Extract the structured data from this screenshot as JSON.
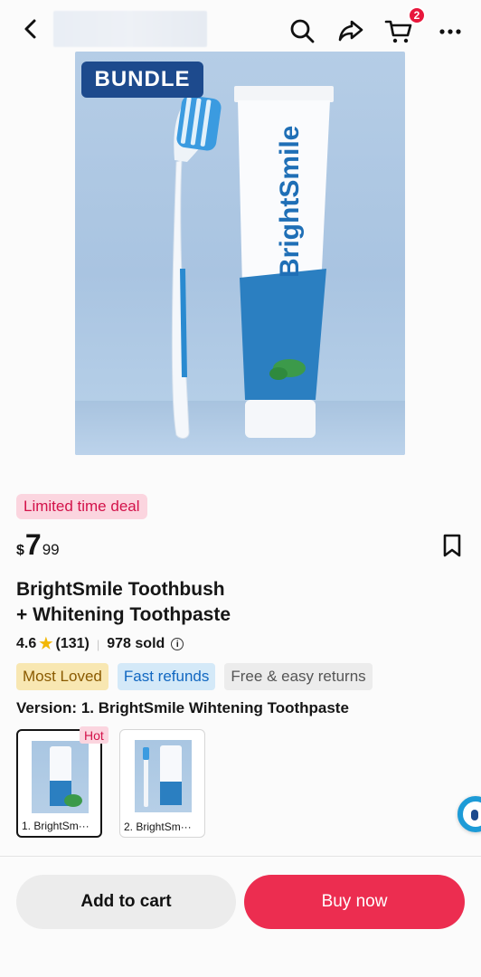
{
  "topbar": {
    "cart_count": "2",
    "icons": [
      "back-icon",
      "search-icon",
      "share-icon",
      "cart-icon",
      "more-icon"
    ]
  },
  "hero": {
    "badge": "BUNDLE",
    "brand_on_tube": "BrightSmile"
  },
  "deal": {
    "label": "Limited time deal"
  },
  "price": {
    "currency": "$",
    "whole": "7",
    "cents": "99"
  },
  "product": {
    "title_line1": "BrightSmile Toothbush",
    "title_line2": "+ Whitening Toothpaste",
    "rating": "4.6",
    "reviews": "(131)",
    "sold": "978 sold"
  },
  "chips": [
    "Most Loved",
    "Fast refunds",
    "Free & easy returns"
  ],
  "version": {
    "label": "Version:",
    "value": "1. BrightSmile Wihtening Toothpaste"
  },
  "variants": [
    {
      "label": "1. BrightSm···",
      "tag": "Hot",
      "selected": true
    },
    {
      "label": "2. BrightSm···",
      "selected": false
    }
  ],
  "actions": {
    "add_to_cart": "Add to cart",
    "buy_now": "Buy now"
  },
  "colors": {
    "accent": "#ec2d50",
    "badge_bg": "#1d4a8d",
    "deal_bg": "#fbd5df",
    "deal_text": "#d3124a"
  }
}
